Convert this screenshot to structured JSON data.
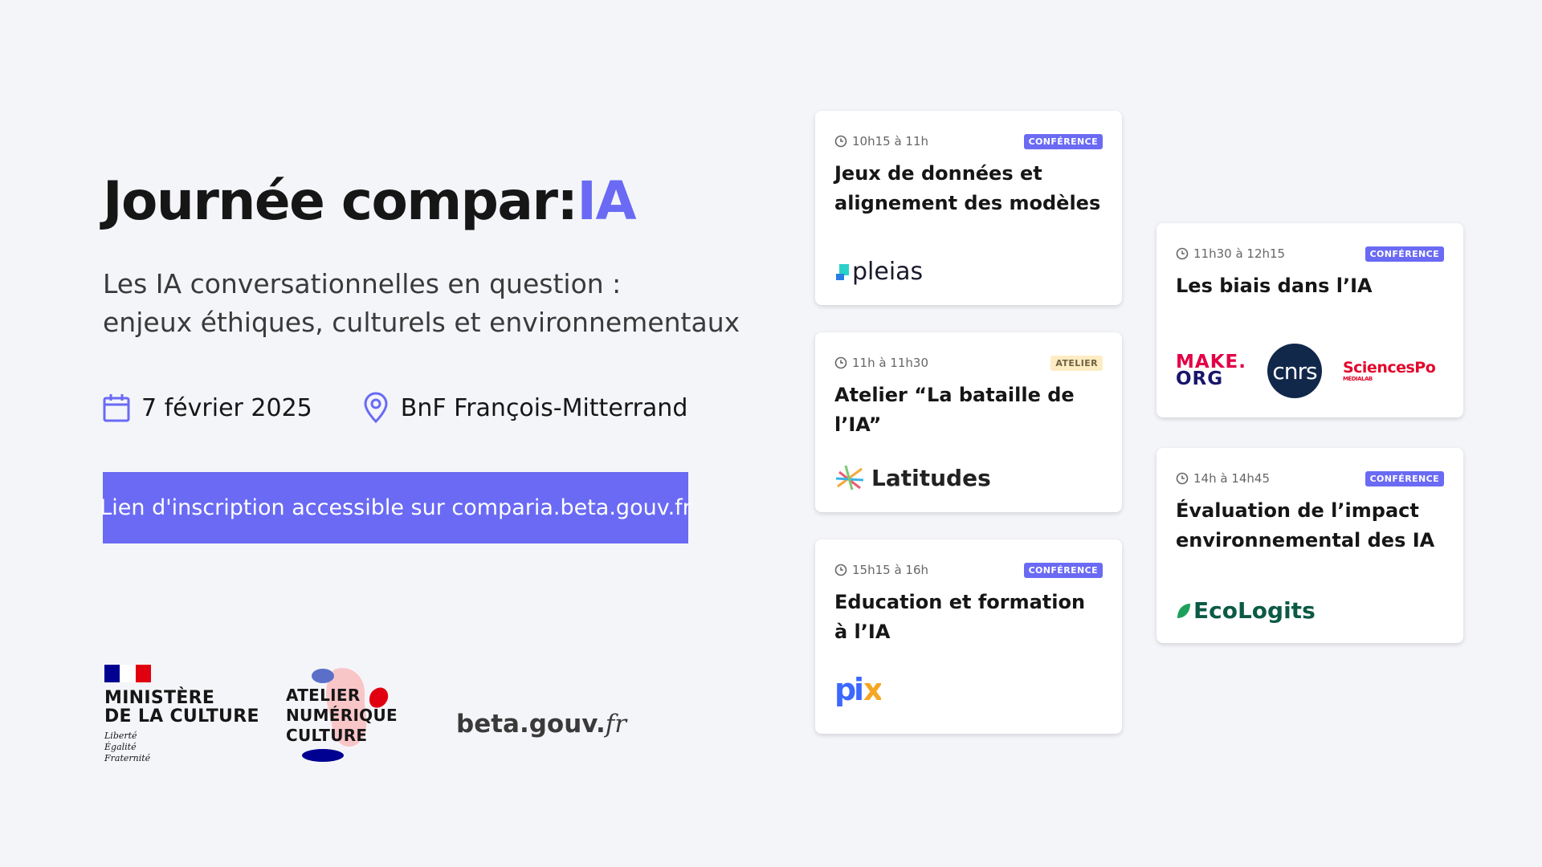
{
  "header": {
    "title_main": "Journée compar:",
    "title_accent": "IA",
    "subtitle_line1": "Les IA conversationnelles en question :",
    "subtitle_line2": "enjeux éthiques, culturels et environnementaux"
  },
  "event": {
    "date": "7 février 2025",
    "location": "BnF François-Mitterrand"
  },
  "cta": {
    "label": "Lien d'inscription accessible sur comparia.beta.gouv.fr"
  },
  "partners": {
    "ministere_line1": "MINISTÈRE",
    "ministere_line2": "DE LA CULTURE",
    "motto1": "Liberté",
    "motto2": "Égalité",
    "motto3": "Fraternité",
    "anc_line1": "ATELIER",
    "anc_line2": "NUMÉRIQUE",
    "anc_line3": "CULTURE",
    "beta_main": "beta.gouv.",
    "beta_fr": "fr"
  },
  "colors": {
    "accent": "#6a6af4",
    "background": "#f4f5f9",
    "badge_conference_bg": "#6a6af4",
    "badge_atelier_bg": "#feecc2"
  },
  "sessions": [
    {
      "time": "10h15 à 11h",
      "type": "CONFÉRENCE",
      "title": "Jeux de données et alignement des modèles",
      "logo": "pleias"
    },
    {
      "time": "11h à 11h30",
      "type": "ATELIER",
      "title": "Atelier “La bataille de l’IA”",
      "logo": "Latitudes"
    },
    {
      "time": "15h15 à 16h",
      "type": "CONFÉRENCE",
      "title": "Education et formation à l’IA",
      "logo": "pix"
    },
    {
      "time": "11h30 à 12h15",
      "type": "CONFÉRENCE",
      "title": "Les biais dans l’IA",
      "logos": [
        "MAKE.",
        "ORG",
        "cnrs",
        "SciencesPo",
        "MÉDIALAB"
      ]
    },
    {
      "time": "14h à 14h45",
      "type": "CONFÉRENCE",
      "title": "Évaluation de l’impact environnemental des IA",
      "logo": "EcoLogits"
    }
  ]
}
